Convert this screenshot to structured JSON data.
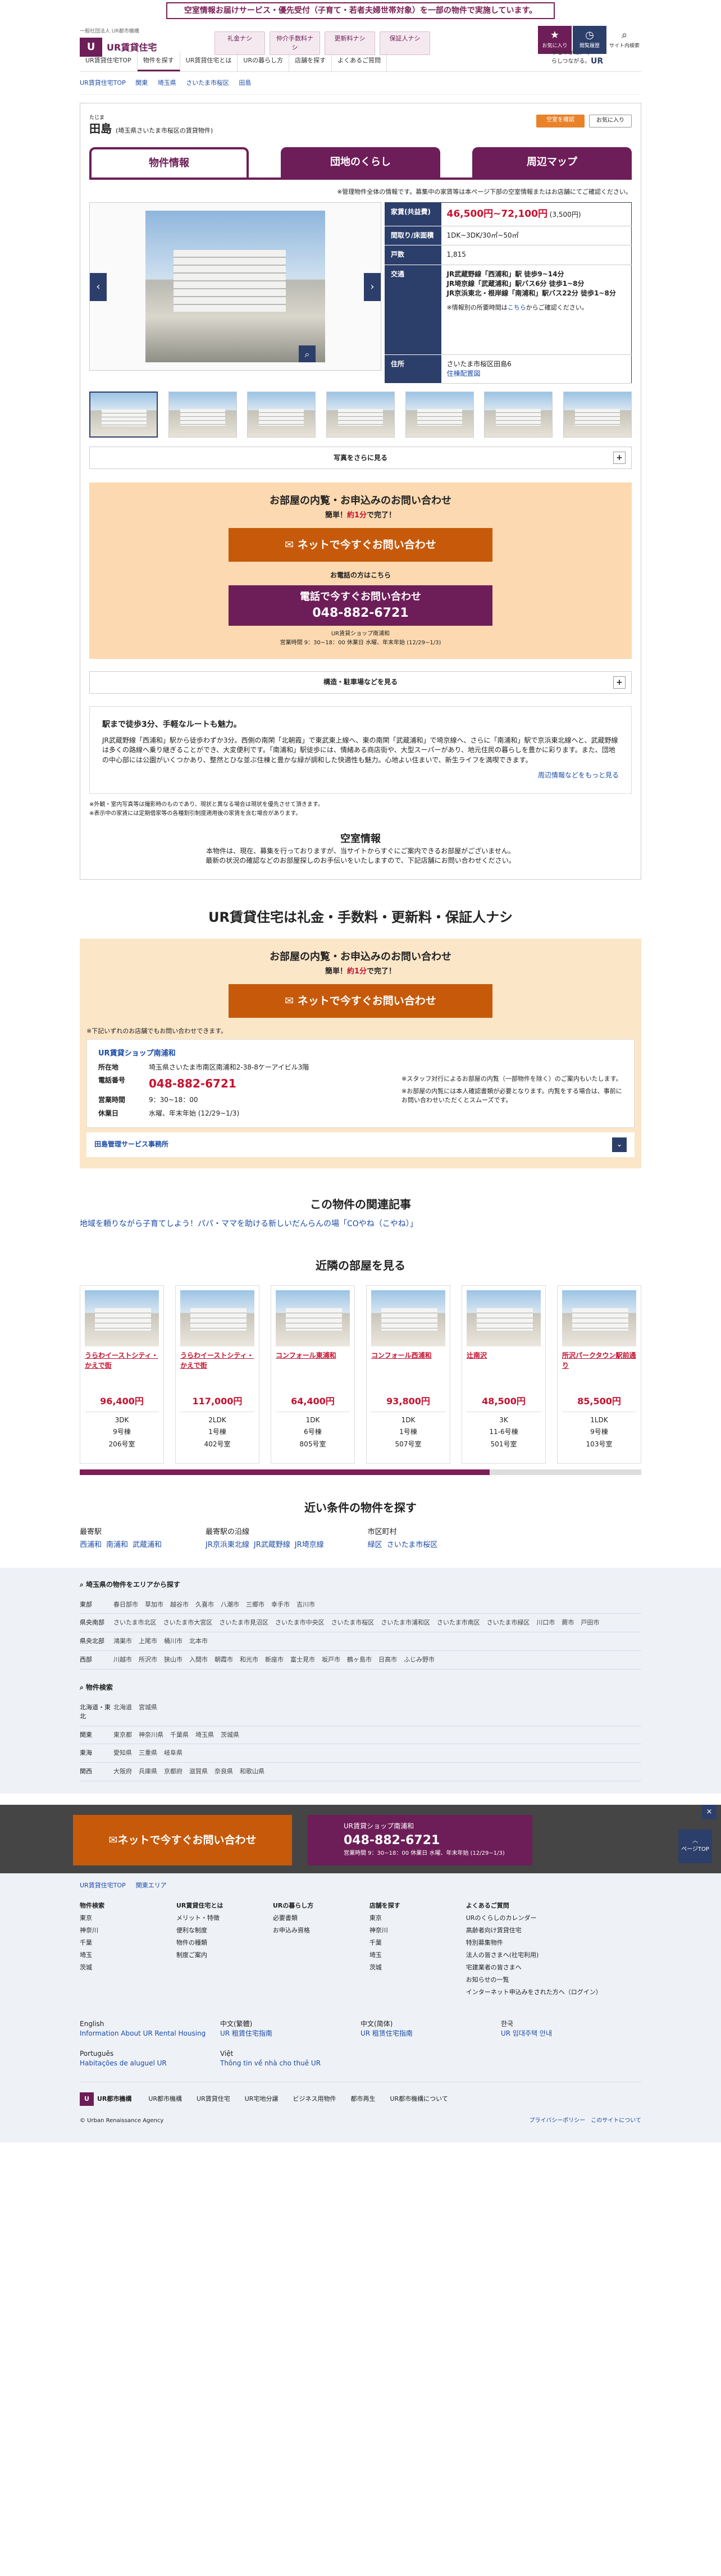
{
  "notice": "空室情報お届けサービス・優先受付（子育て・若者夫婦世帯対象）を一部の物件で実施しています。",
  "header": {
    "tagline": "一般社団法人 UR都市機構",
    "brand": "UR賃貸住宅",
    "top_links": [
      "礼金ナシ",
      "仲介手数料ナシ",
      "更新料ナシ",
      "保証人ナシ"
    ],
    "icons": [
      {
        "name": "star-icon",
        "label": "お気に入り",
        "glyph": "★"
      },
      {
        "name": "clock-icon",
        "label": "閲覧履歴",
        "glyph": "◷"
      },
      {
        "name": "search-icon",
        "label": "サイト内検索",
        "glyph": "⌕"
      }
    ],
    "gnav": [
      "UR賃貸住宅TOP",
      "物件を探す",
      "UR賃貸住宅とは",
      "URの暮らし方",
      "店舗を探す",
      "よくあるご質問"
    ],
    "right_text": "ゆるやかに、くらしつながる。",
    "right_logo": "UR"
  },
  "breadcrumb": [
    "UR賃貸住宅TOP",
    "関東",
    "埼玉県",
    "さいたま市桜区",
    "田島"
  ],
  "property": {
    "ruby": "たじま",
    "name": "田島",
    "sub": "(埼玉県さいたま市桜区の賃貸物件)",
    "fav_button": "空室を確認",
    "compare_button": "お気に入り"
  },
  "tabs": [
    "物件情報",
    "団地のくらし",
    "周辺マップ"
  ],
  "note_top": "※管理物件全体の情報です。募集中の家賃等は本ページ下部の空室情報またはお店舗にてご確認ください。",
  "spec": {
    "rent_label": "家賃(共益費)",
    "rent_value": "46,500円~72,100円",
    "rent_extra": "(3,500円)",
    "layout_label": "間取り/床面積",
    "layout_value": "1DK~3DK/30㎡~50㎡",
    "units_label": "戸数",
    "units_value": "1,815",
    "access_label": "交通",
    "access_lines": [
      "JR武蔵野線「西浦和」駅 徒歩9~14分",
      "JR埼京線「武蔵浦和」駅バス6分 徒歩1~8分",
      "JR京浜東北・根岸線「南浦和」駅バス22分 徒歩1~8分"
    ],
    "access_note_pre": "※情報別の所要時間は",
    "access_note_link": "こちら",
    "access_note_post": "からご確認ください。",
    "address_label": "住所",
    "address_value": "さいたま市桜区田島6",
    "address_link": "住棟配置図"
  },
  "photo_more": "写真をさらに見る",
  "inquiry": {
    "heading": "お部屋の内覧・お申込みのお問い合わせ",
    "sub_pre": "簡単！",
    "sub_em": "約1分",
    "sub_post": "で完了！",
    "net_button": "ネットで今すぐお問い合わせ",
    "phone_label": "お電話の方はこちら",
    "tel_line1": "電話で今すぐお問い合わせ",
    "tel_number": "048-882-6721",
    "shop_line": "UR賃貸ショップ南浦和",
    "hours_line": "営業時間 9：30~18：00 休業日 水曜、年末年始 (12/29~1/3)"
  },
  "structure_bar": "構造・駐車場などを見る",
  "desc": {
    "heading": "駅まで徒歩3分、手軽なルートも魅力。",
    "body": "JR武蔵野線「西浦和」駅から徒歩わずか3分。西側の南閑「北朝霞」で東武東上線へ、東の南閑「武蔵浦和」で埼京線へ、さらに「南浦和」駅で京浜東北線へと、武蔵野線は多くの路線へ乗り継ぎることができ、大変便利です。「南浦和」駅徒歩には、情緒ある商店街や、大型スーパーがあり、地元住民の暮らしを豊かに彩ります。また、団地の中心部には公園がいくつかあり、整然とひな並ぶ住棟と豊かな緑が調和した快適性も魅力。心地よい住まいで、新生ライフを満喫できます。",
    "more": "周辺情報などをもっと見る"
  },
  "fine_print": [
    "※外観・室内写真等は撮影時のものであり、現状と異なる場合は現状を優先させて頂きます。",
    "※表示中の家賃には定期借家等の各種割引制度適用後の家賃を含む場合があります。"
  ],
  "vacancy": {
    "heading": "空室情報",
    "line1": "本物件は、現在、募集を行っておりますが、当サイトからすぐにご案内できるお部屋がございません。",
    "line2": "最新の状況の確認などのお部屋探しのお手伝いをいたしますので、下記店舗にお問い合わせください。"
  },
  "merit_title": "UR賃貸住宅は礼金・手数料・更新料・保証人ナシ",
  "shop": {
    "note": "※下記いずれのお店舗でもお問い合わせできます。",
    "name": "UR賃貸ショップ南浦和",
    "addr_label": "所在地",
    "addr": "埼玉県さいたま市南区南浦和2-38-8ケーアイビル3階",
    "tel_label": "電話番号",
    "tel": "048-882-6721",
    "hours_label": "営業時間",
    "hours": "9：30~18：00",
    "closed_label": "休業日",
    "closed": "水曜、年末年始 (12/29~1/3)",
    "right1": "※スタッフ対行によるお部屋の内覧（一部物件を除く）のご案内もいたします。",
    "right2": "※お部屋の内覧には本人確認書類が必要となります。内覧をする場合は、事前にお問い合わせいただくとスムーズです。",
    "area_bar": "田島管理サービス事務所"
  },
  "article": {
    "heading": "この物件の関連記事",
    "link": "地域を頼りながら子育てしよう！パパ・ママを助ける新しいだんらんの場「COやね（こやね）」"
  },
  "nearby": {
    "heading": "近隣の部屋を見る",
    "cards": [
      {
        "name": "うらわイーストシティ・ かえで街",
        "price": "96,400円",
        "layout": "3DK",
        "floor": "9号棟",
        "size": "206号室"
      },
      {
        "name": "うらわイーストシティ・ かえで街",
        "price": "117,000円",
        "layout": "2LDK",
        "floor": "1号棟",
        "size": "402号室"
      },
      {
        "name": "コンフォール東浦和",
        "price": "64,400円",
        "layout": "1DK",
        "floor": "6号棟",
        "size": "805号室"
      },
      {
        "name": "コンフォール西浦和",
        "price": "93,800円",
        "layout": "1DK",
        "floor": "1号棟",
        "size": "507号室"
      },
      {
        "name": "辻南沢",
        "price": "48,500円",
        "layout": "3K",
        "floor": "11-6号棟",
        "size": "501号室"
      },
      {
        "name": "所沢パークタウン駅前通り",
        "price": "85,500円",
        "layout": "1LDK",
        "floor": "9号棟",
        "size": "103号室"
      }
    ]
  },
  "conditions": {
    "heading": "近い条件の物件を探す",
    "groups": [
      {
        "label": "最寄駅",
        "links": [
          "西浦和",
          "南浦和",
          "武蔵浦和"
        ]
      },
      {
        "label": "最寄駅の沿線",
        "links": [
          "JR京浜東北線",
          "JR武蔵野線",
          "JR埼京線"
        ]
      },
      {
        "label": "市区町村",
        "links": [
          "緑区",
          "さいたま市桜区"
        ]
      }
    ]
  },
  "area_search": {
    "heading": "埼玉県の物件をエリアから探す",
    "rows": [
      {
        "k": "東部",
        "v": [
          "春日部市",
          "草加市",
          "越谷市",
          "久喜市",
          "八潮市",
          "三郷市",
          "幸手市",
          "吉川市"
        ]
      },
      {
        "k": "県央南部",
        "v": [
          "さいたま市北区",
          "さいたま市大宮区",
          "さいたま市見沼区",
          "さいたま市中央区",
          "さいたま市桜区",
          "さいたま市浦和区",
          "さいたま市南区",
          "さいたま市緑区",
          "川口市",
          "蕨市",
          "戸田市"
        ]
      },
      {
        "k": "県央北部",
        "v": [
          "鴻巣市",
          "上尾市",
          "桶川市",
          "北本市"
        ]
      },
      {
        "k": "西部",
        "v": [
          "川越市",
          "所沢市",
          "狭山市",
          "入間市",
          "朝霞市",
          "和光市",
          "新座市",
          "富士見市",
          "坂戸市",
          "鶴ヶ島市",
          "日高市",
          "ふじみ野市"
        ]
      }
    ],
    "pref_heading": "物件検索",
    "pref_rows": [
      {
        "k": "北海道・東北",
        "v": [
          "北海道",
          "宮城県"
        ]
      },
      {
        "k": "関東",
        "v": [
          "東京都",
          "神奈川県",
          "千葉県",
          "埼玉県",
          "茨城県"
        ]
      },
      {
        "k": "東海",
        "v": [
          "愛知県",
          "三重県",
          "岐阜県"
        ]
      },
      {
        "k": "関西",
        "v": [
          "大阪府",
          "兵庫県",
          "京都府",
          "滋賀県",
          "奈良県",
          "和歌山県"
        ]
      }
    ]
  },
  "float": {
    "net": "ネットで今すぐお問い合わせ",
    "shop": "UR賃貸ショップ南浦和",
    "tel": "048-882-6721",
    "hours": "営業時間 9：30~18：00 休業日 水曜、年末年始 (12/29~1/3)",
    "top": "ページTOP"
  },
  "footer": {
    "crumbs": [
      "UR賃貸住宅TOP",
      "関東エリア"
    ],
    "cols": [
      {
        "h": "物件検索",
        "items": [
          "東京",
          "神奈川",
          "千葉",
          "埼玉",
          "茨城"
        ]
      },
      {
        "h": "UR賃貸住宅とは",
        "items": [
          "メリット・特徴",
          "便利な制度",
          "物件の種類",
          "制度ご案内"
        ]
      },
      {
        "h": "URの暮らし方",
        "items": [
          "必要書類",
          "お申込み資格"
        ]
      },
      {
        "h": "店舗を探す",
        "items": [
          "東京",
          "神奈川",
          "千葉",
          "埼玉",
          "茨城"
        ]
      },
      {
        "h": "よくあるご質問",
        "items": [
          "URのくらしのカレンダー",
          "高齢者向け賃貸住宅",
          "特別募集物件",
          "法人の皆さまへ(社宅利用)",
          "宅建業者の皆さまへ",
          "お知らせの一覧",
          "インターネット申込みをされた方へ（ログイン）"
        ]
      }
    ],
    "langs": [
      {
        "h": "English",
        "t": "Information About UR Rental Housing"
      },
      {
        "h": "中文(繁體)",
        "t": "UR 租賃住宅指南"
      },
      {
        "h": "中文(简体)",
        "t": "UR 租赁住宅指南"
      },
      {
        "h": "한국",
        "t": "UR 임대주택 안내"
      },
      {
        "h": "Português",
        "t": "Habitações de aluguel UR"
      },
      {
        "h": "Việt",
        "t": "Thông tin về nhà cho thuê UR"
      }
    ],
    "brand": "UR都市機構",
    "bottom_links": [
      "UR都市機構",
      "UR賃貸住宅",
      "UR宅地分譲",
      "ビジネス用物件",
      "都市再生",
      "UR都市機構について"
    ],
    "copyright": "© Urban Renaissance Agency",
    "policy": "プライバシーポリシー",
    "about": "このサイトについて"
  }
}
